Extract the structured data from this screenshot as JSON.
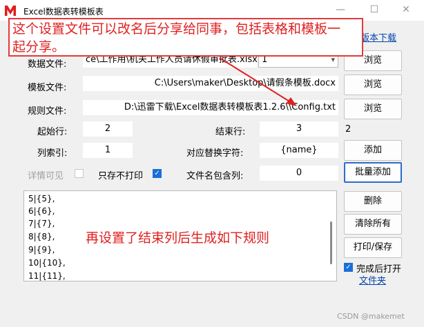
{
  "window": {
    "title": "Excel数据表转模板表",
    "min_glyph": "—",
    "max_glyph": "☐",
    "close_glyph": "✕"
  },
  "links": {
    "version_download": "版本下载",
    "folder": "文件夹"
  },
  "form": {
    "data_file_label": "数据文件:",
    "data_file_value": "ce\\工作用\\机关工作人员请休假审批表.xlsx",
    "sheet_value": "1",
    "template_file_label": "模板文件:",
    "template_file_value": "C:\\Users\\maker\\Desktop\\请假条模板.docx",
    "rule_file_label": "规则文件:",
    "rule_file_value": "D:\\迅雷下载\\Excel数据表转模板表1.2.6\\\\Config.txt",
    "start_row_label": "起始行:",
    "start_row_value": "2",
    "end_row_label": "结束行:",
    "end_row_value": "3",
    "end_row_side": "2",
    "column_index_label": "列索引:",
    "column_index_value": "1",
    "replace_char_label": "对应替换字符:",
    "replace_char_value": "{name}",
    "filename_col_label": "文件名包含列:",
    "filename_col_value": "0",
    "detail_visible_label": "详情可见",
    "save_only_label": "只存不打印",
    "open_after_label": "完成后打开"
  },
  "buttons": {
    "browse": "浏览",
    "add": "添加",
    "batch_add": "批量添加",
    "delete": "删除",
    "clear_all": "清除所有",
    "print_save": "打印/保存"
  },
  "rules_list": [
    "5|{5},",
    "6|{6},",
    "7|{7},",
    "8|{8},",
    "9|{9},",
    "10|{10},",
    "11|{11},"
  ],
  "annotations": {
    "top_line1": "这个设置文件可以改名后分享给同事，包括表格和模板一",
    "top_line2": "起分享。",
    "middle": "再设置了结束列后生成如下规则",
    "color": "#e02020"
  },
  "watermark": "CSDN @makemet"
}
